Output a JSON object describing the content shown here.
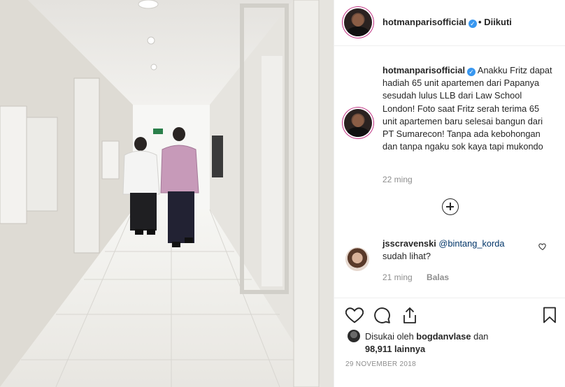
{
  "post": {
    "username": "hotmanparisofficial",
    "follow_separator": "•",
    "follow_status": "Diikuti"
  },
  "caption": {
    "username": "hotmanparisofficial",
    "text": "Anakku Fritz dapat hadiah 65 unit apartemen dari Papanya sesudah lulus LLB dari Law School London! Foto saat Fritz serah terima 65 unit apartemen baru selesai bangun dari PT Sumarecon! Tanpa ada kebohongan dan tanpa ngaku sok kaya tapi mukondo",
    "time": "22 ming"
  },
  "comment": {
    "username": "jsscravenski",
    "mention": "@bintang_korda",
    "text": "sudah lihat?",
    "time": "21 ming",
    "reply_label": "Balas"
  },
  "likes": {
    "prefix": "Disukai oleh",
    "user": "bogdanvlase",
    "middle": "dan",
    "count": "98,911",
    "suffix": "lainnya"
  },
  "date": "29 NOVEMBER 2018",
  "icons": {
    "verified": "verified-badge",
    "like": "heart-icon",
    "comment": "comment-icon",
    "share": "share-icon",
    "save": "bookmark-icon",
    "load_more": "plus-circle-icon"
  },
  "colors": {
    "verified": "#3897f0",
    "text": "#262626",
    "muted": "#8e8e8e"
  }
}
